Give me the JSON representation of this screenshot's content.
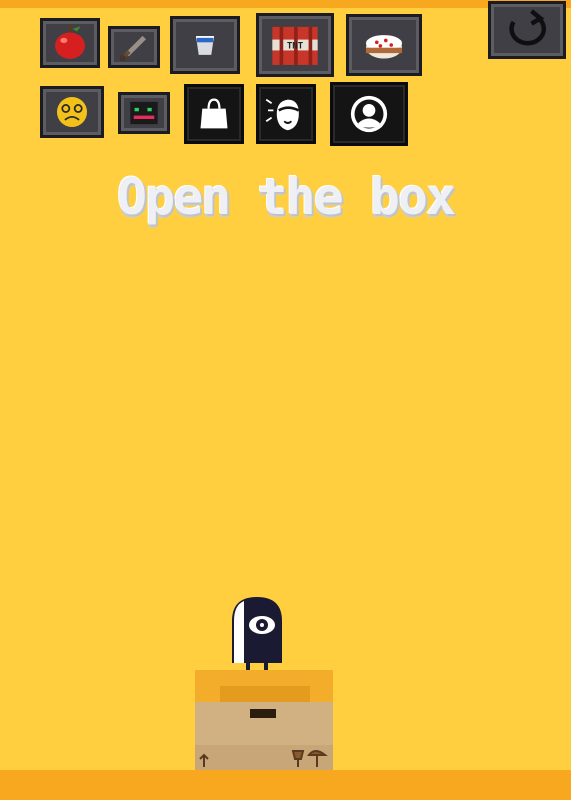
{
  "title": "Open the box",
  "inventory": [
    {
      "name": "apple",
      "icon": "apple-icon"
    },
    {
      "name": "sword",
      "icon": "sword-icon"
    },
    {
      "name": "bucket",
      "icon": "bucket-icon"
    },
    {
      "name": "tnt",
      "icon": "tnt-icon",
      "label": "TNT"
    },
    {
      "name": "cake",
      "icon": "cake-icon"
    },
    {
      "name": "sad-face",
      "icon": "sad-face-icon"
    },
    {
      "name": "robot-head",
      "icon": "robot-head-icon"
    },
    {
      "name": "shopping-bag",
      "icon": "shopping-bag-icon"
    },
    {
      "name": "character-portrait",
      "icon": "character-portrait-icon"
    },
    {
      "name": "profile",
      "icon": "profile-icon"
    }
  ],
  "restart_icon": "restart-icon",
  "colors": {
    "background": "#ffcf40",
    "accent": "#f7a81e",
    "box": "#d1b182",
    "creature": "#1b1a33"
  }
}
